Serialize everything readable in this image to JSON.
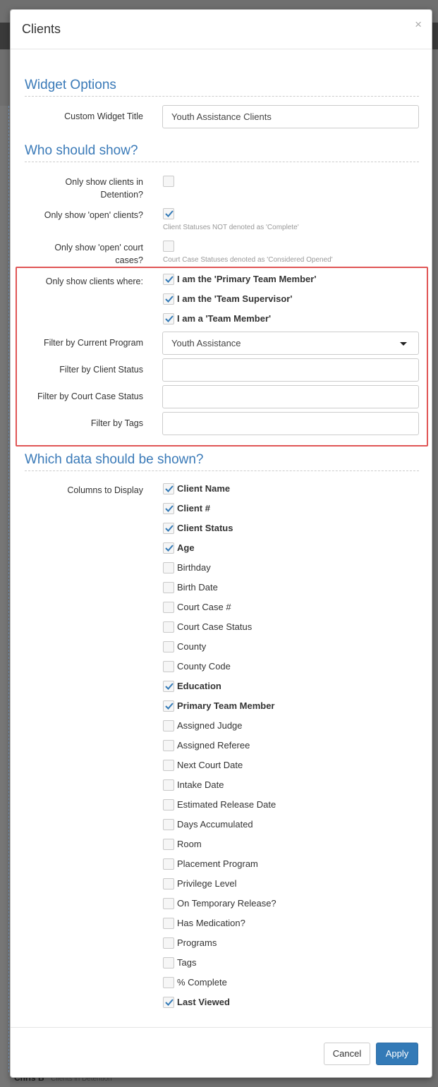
{
  "modal": {
    "title": "Clients",
    "close_symbol": "×"
  },
  "widget_options": {
    "section_title": "Widget Options",
    "custom_title_label": "Custom Widget Title",
    "custom_title_value": "Youth Assistance Clients"
  },
  "who_should_show": {
    "section_title": "Who should show?",
    "detention_label": "Only show clients in Detention?",
    "detention_checked": false,
    "open_clients_label": "Only show 'open' clients?",
    "open_clients_checked": true,
    "open_clients_hint": "Client Statuses NOT denoted as 'Complete'",
    "open_court_label": "Only show 'open' court cases?",
    "open_court_checked": false,
    "open_court_hint": "Court Case Statuses denoted as 'Considered Opened'",
    "clients_where_label": "Only show clients where:",
    "clients_where": [
      {
        "label": "I am the 'Primary Team Member'",
        "checked": true
      },
      {
        "label": "I am the 'Team Supervisor'",
        "checked": true
      },
      {
        "label": "I am a 'Team Member'",
        "checked": true
      }
    ],
    "program_label": "Filter by Current Program",
    "program_value": "Youth Assistance",
    "client_status_label": "Filter by Client Status",
    "client_status_value": "",
    "court_status_label": "Filter by Court Case Status",
    "court_status_value": "",
    "tags_label": "Filter by Tags",
    "tags_value": ""
  },
  "data_shown": {
    "section_title": "Which data should be shown?",
    "columns_label": "Columns to Display",
    "columns": [
      {
        "label": "Client Name",
        "checked": true
      },
      {
        "label": "Client #",
        "checked": true
      },
      {
        "label": "Client Status",
        "checked": true
      },
      {
        "label": "Age",
        "checked": true
      },
      {
        "label": "Birthday",
        "checked": false
      },
      {
        "label": "Birth Date",
        "checked": false
      },
      {
        "label": "Court Case #",
        "checked": false
      },
      {
        "label": "Court Case Status",
        "checked": false
      },
      {
        "label": "County",
        "checked": false
      },
      {
        "label": "County Code",
        "checked": false
      },
      {
        "label": "Education",
        "checked": true
      },
      {
        "label": "Primary Team Member",
        "checked": true
      },
      {
        "label": "Assigned Judge",
        "checked": false
      },
      {
        "label": "Assigned Referee",
        "checked": false
      },
      {
        "label": "Next Court Date",
        "checked": false
      },
      {
        "label": "Intake Date",
        "checked": false
      },
      {
        "label": "Estimated Release Date",
        "checked": false
      },
      {
        "label": "Days Accumulated",
        "checked": false
      },
      {
        "label": "Room",
        "checked": false
      },
      {
        "label": "Placement Program",
        "checked": false
      },
      {
        "label": "Privilege Level",
        "checked": false
      },
      {
        "label": "On Temporary Release?",
        "checked": false
      },
      {
        "label": "Has Medication?",
        "checked": false
      },
      {
        "label": "Programs",
        "checked": false
      },
      {
        "label": "Tags",
        "checked": false
      },
      {
        "label": "% Complete",
        "checked": false
      },
      {
        "label": "Last Viewed",
        "checked": true
      }
    ]
  },
  "footer": {
    "cancel_label": "Cancel",
    "apply_label": "Apply"
  },
  "background": {
    "peek_text": "Chris B",
    "peek_sub": "Clients in Detention"
  },
  "colors": {
    "accent": "#337ab7",
    "highlight": "#e05555",
    "section_title": "#3a7ab8"
  }
}
